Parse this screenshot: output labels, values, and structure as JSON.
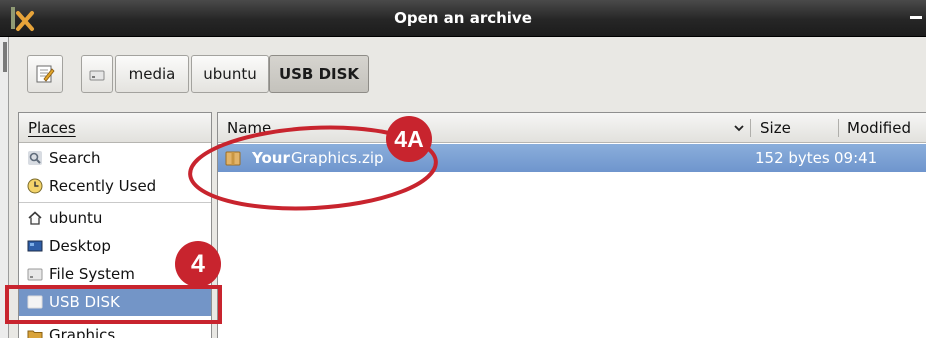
{
  "window": {
    "title": "Open an archive"
  },
  "path_bar": {
    "crumbs": [
      "media",
      "ubuntu",
      "USB DISK"
    ]
  },
  "places": {
    "header": "Places",
    "items": [
      {
        "label": "Search",
        "icon": "search-icon"
      },
      {
        "label": "Recently Used",
        "icon": "clock-icon"
      },
      {
        "label": "ubuntu",
        "icon": "home-icon"
      },
      {
        "label": "Desktop",
        "icon": "desktop-icon"
      },
      {
        "label": "File System",
        "icon": "drive-icon"
      },
      {
        "label": "USB DISK",
        "icon": "usb-drive-icon",
        "selected": true
      },
      {
        "label": "Graphics",
        "icon": "folder-icon"
      }
    ]
  },
  "files": {
    "columns": {
      "name": "Name",
      "size": "Size",
      "modified": "Modified"
    },
    "rows": [
      {
        "name_prefix": "Your",
        "name_rest": "Graphics.zip",
        "size": "152 bytes",
        "modified": "09:41",
        "selected": true
      }
    ]
  },
  "annotations": {
    "badge_places": "4",
    "badge_file": "4A",
    "color": "#c8242e"
  },
  "colors": {
    "selection": "#7395c7",
    "titlebar": "#262626"
  }
}
